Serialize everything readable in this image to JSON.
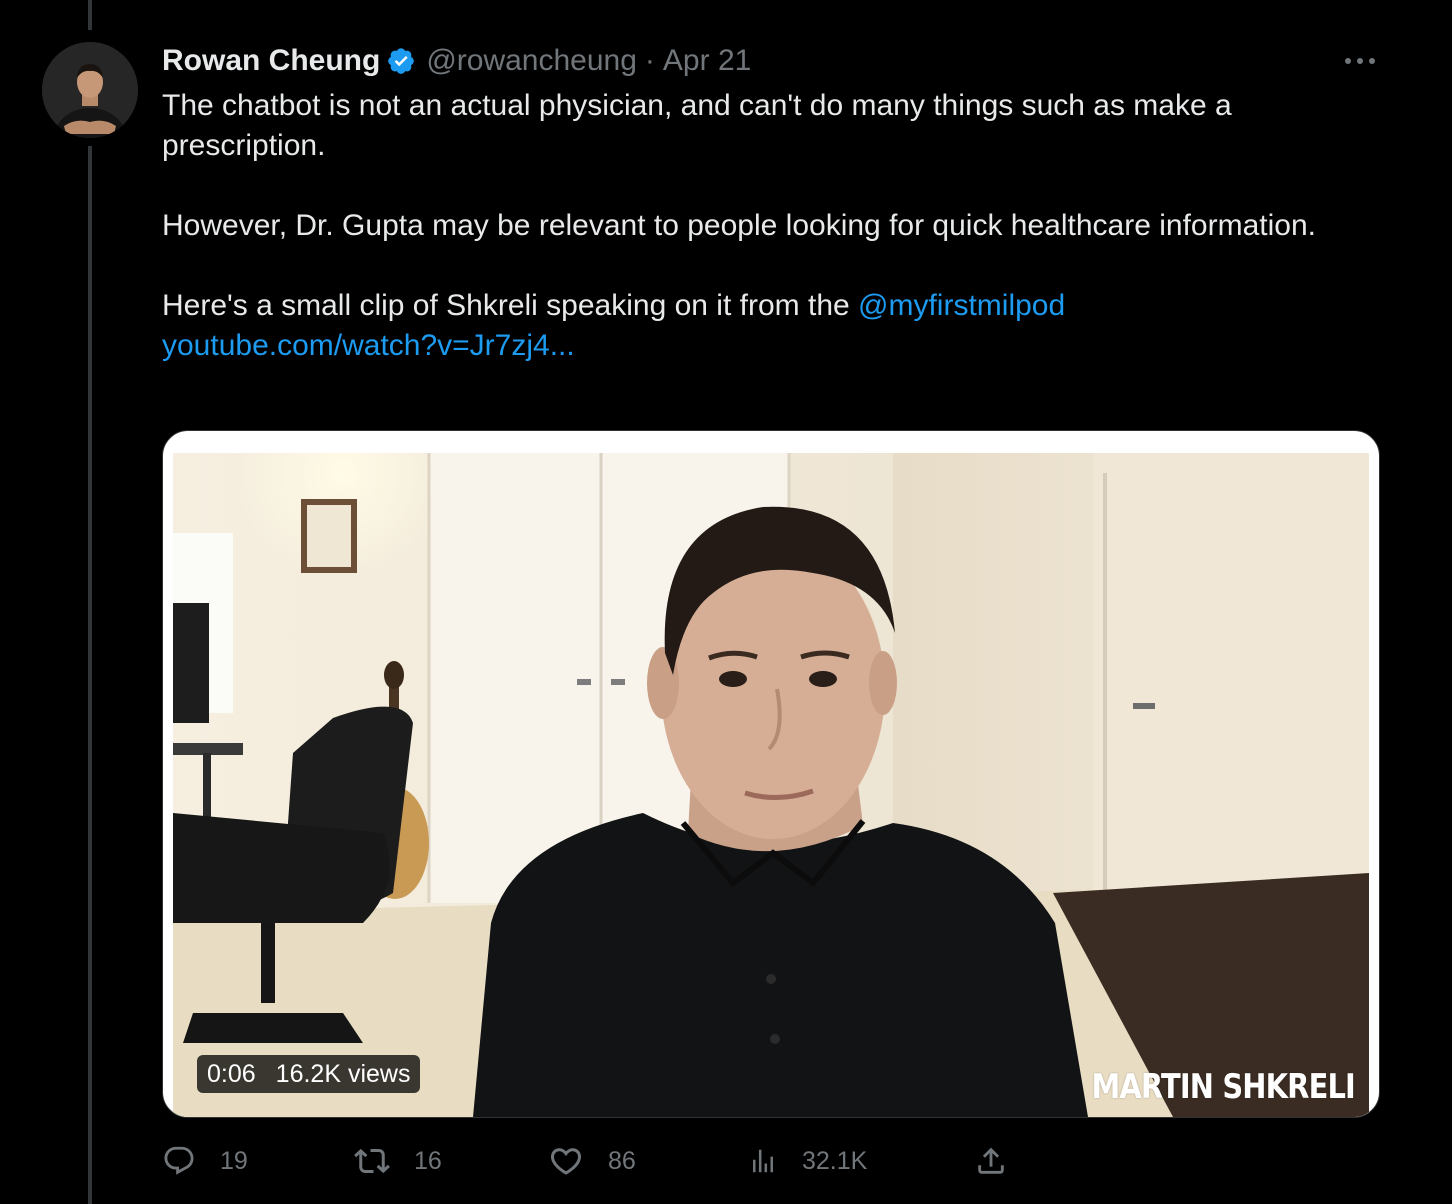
{
  "tweet": {
    "author": {
      "display_name": "Rowan Cheung",
      "handle": "@rowancheung",
      "verified_icon": "verified-badge-icon",
      "avatar_icon": "avatar-photo"
    },
    "separator": "·",
    "date": "Apr 21",
    "more_icon": "more-icon",
    "paragraphs": [
      "The chatbot is not an actual physician, and can't do many things such as make a prescription.",
      "However, Dr. Gupta may be relevant to people looking for quick healthcare information."
    ],
    "p3_text": "Here's a small clip of Shkreli speaking on it from the ",
    "mention": "@myfirstmilpod",
    "url": "youtube.com/watch?v=Jr7zj4...",
    "video": {
      "time": "0:06",
      "views": "16.2K views",
      "watermark": "MARTIN SHKRELI"
    },
    "actions": {
      "replies": "19",
      "retweets": "16",
      "likes": "86",
      "views": "32.1K"
    },
    "colors": {
      "background": "#000000",
      "text": "#e7e9ea",
      "muted": "#71767b",
      "link": "#1d9bf0",
      "verified": "#1d9bf0"
    }
  }
}
